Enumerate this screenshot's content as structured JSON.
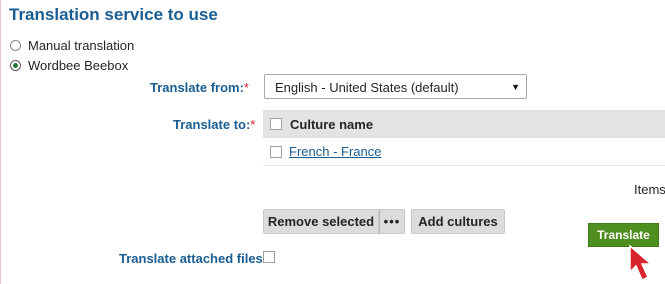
{
  "section": {
    "title": "Translation service to use"
  },
  "service_options": [
    {
      "label": "Manual translation",
      "selected": false
    },
    {
      "label": "Wordbee Beebox",
      "selected": true
    }
  ],
  "translate_from": {
    "label": "Translate from:",
    "required_mark": "*",
    "value": "English - United States (default)"
  },
  "translate_to": {
    "label": "Translate to:",
    "required_mark": "*",
    "column_header": "Culture name",
    "rows": [
      {
        "name": "French - France",
        "checked": false
      }
    ]
  },
  "pager": {
    "text": "Items p"
  },
  "buttons": {
    "remove_selected": "Remove selected",
    "more": "•••",
    "add_cultures": "Add cultures",
    "translate": "Translate"
  },
  "attached_files": {
    "label": "Translate attached files:",
    "checked": false
  },
  "colors": {
    "heading": "#1a5d92",
    "translate_button": "#4e8f1f",
    "cursor": "#d9232e"
  }
}
